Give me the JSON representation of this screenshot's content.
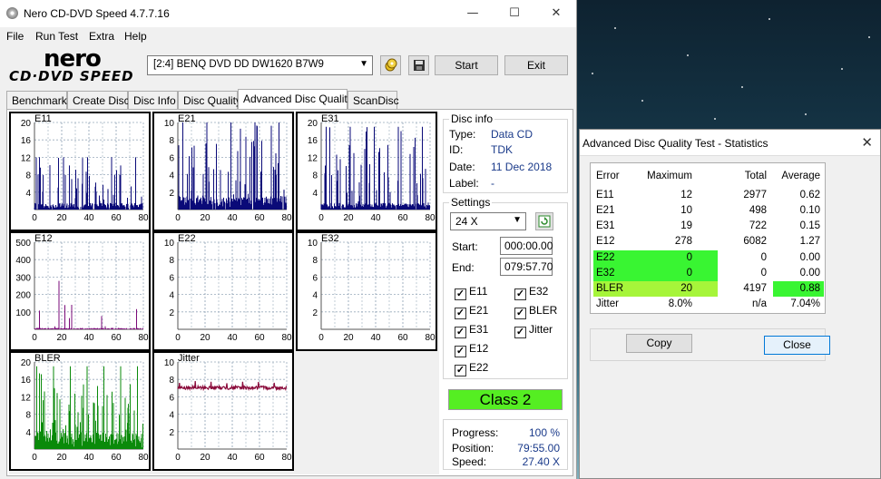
{
  "window": {
    "title": "Nero CD-DVD Speed 4.7.7.16",
    "minimize": "—",
    "maximize": "☐",
    "close": "✕"
  },
  "menu": [
    "File",
    "Run Test",
    "Extra",
    "Help"
  ],
  "logo": {
    "top": "nero",
    "bottom": "CD·DVD SPEED"
  },
  "toolbar": {
    "drive": "[2:4]   BENQ DVD DD DW1620 B7W9",
    "start_label": "Start",
    "exit_label": "Exit"
  },
  "tabs": [
    "Benchmark",
    "Create Disc",
    "Disc Info",
    "Disc Quality",
    "Advanced Disc Quality",
    "ScanDisc"
  ],
  "active_tab": "Advanced Disc Quality",
  "disc_info": {
    "title": "Disc info",
    "type_label": "Type:",
    "type": "Data CD",
    "id_label": "ID:",
    "id": "TDK",
    "date_label": "Date:",
    "date": "11 Dec 2018",
    "label_label": "Label:",
    "label": "-"
  },
  "settings": {
    "title": "Settings",
    "speed": "24 X",
    "start_label": "Start:",
    "start": "000:00.00",
    "end_label": "End:",
    "end": "079:57.70",
    "checks": [
      "E11",
      "E32",
      "E21",
      "BLER",
      "E31",
      "Jitter",
      "E12",
      "E22"
    ]
  },
  "class_label": "Class 2",
  "progress": {
    "progress_label": "Progress:",
    "progress": "100 %",
    "position_label": "Position:",
    "position": "79:55.00",
    "speed_label": "Speed:",
    "speed": "27.40 X"
  },
  "dialog": {
    "title": "Advanced Disc Quality Test - Statistics",
    "headers": [
      "Error",
      "Maximum",
      "Total",
      "Average"
    ],
    "rows": [
      [
        "E11",
        "12",
        "2977",
        "0.62"
      ],
      [
        "E21",
        "10",
        "498",
        "0.10"
      ],
      [
        "E31",
        "19",
        "722",
        "0.15"
      ],
      [
        "E12",
        "278",
        "6082",
        "1.27"
      ],
      [
        "E22",
        "0",
        "0",
        "0.00"
      ],
      [
        "E32",
        "0",
        "0",
        "0.00"
      ],
      [
        "BLER",
        "20",
        "4197",
        "0.88"
      ],
      [
        "Jitter",
        "8.0%",
        "n/a",
        "7.04%"
      ]
    ],
    "copy_label": "Copy",
    "close_label": "Close"
  },
  "colors": {
    "bar_blue": "#0a0a78",
    "bar_purple": "#7a0a78",
    "bar_green": "#0a8a0a",
    "jitter": "#8a0a3a",
    "pass_green": "#39f532",
    "warn_green": "#a6f53a"
  },
  "chart_data": [
    {
      "type": "bar",
      "title": "E11",
      "x": [
        0,
        80
      ],
      "xticks": [
        0,
        20,
        40,
        60,
        80
      ],
      "yticks": [
        4,
        8,
        12,
        16,
        20
      ],
      "ylim": [
        0,
        20
      ],
      "series_max": 12
    },
    {
      "type": "bar",
      "title": "E21",
      "x": [
        0,
        80
      ],
      "xticks": [
        0,
        20,
        40,
        60,
        80
      ],
      "yticks": [
        2,
        4,
        6,
        8,
        10
      ],
      "ylim": [
        0,
        10
      ],
      "series_max": 10
    },
    {
      "type": "bar",
      "title": "E31",
      "x": [
        0,
        80
      ],
      "xticks": [
        0,
        20,
        40,
        60,
        80
      ],
      "yticks": [
        4,
        8,
        12,
        16,
        20
      ],
      "ylim": [
        0,
        20
      ],
      "series_max": 19
    },
    {
      "type": "bar",
      "title": "E12",
      "x": [
        0,
        80
      ],
      "xticks": [
        0,
        20,
        40,
        60,
        80
      ],
      "yticks": [
        100,
        200,
        300,
        400,
        500
      ],
      "ylim": [
        0,
        500
      ],
      "series_max": 278
    },
    {
      "type": "bar",
      "title": "E22",
      "x": [
        0,
        80
      ],
      "xticks": [
        0,
        20,
        40,
        60,
        80
      ],
      "yticks": [
        2,
        4,
        6,
        8,
        10
      ],
      "ylim": [
        0,
        10
      ],
      "series_max": 0
    },
    {
      "type": "bar",
      "title": "E32",
      "x": [
        0,
        80
      ],
      "xticks": [
        0,
        20,
        40,
        60,
        80
      ],
      "yticks": [
        2,
        4,
        6,
        8,
        10
      ],
      "ylim": [
        0,
        10
      ],
      "series_max": 0
    },
    {
      "type": "bar",
      "title": "BLER",
      "x": [
        0,
        80
      ],
      "xticks": [
        0,
        20,
        40,
        60,
        80
      ],
      "yticks": [
        4,
        8,
        12,
        16,
        20
      ],
      "ylim": [
        0,
        20
      ],
      "series_max": 20
    },
    {
      "type": "line",
      "title": "Jitter",
      "x": [
        0,
        80
      ],
      "xticks": [
        0,
        20,
        40,
        60,
        80
      ],
      "yticks": [
        2,
        4,
        6,
        8,
        10
      ],
      "ylim": [
        0,
        10
      ],
      "series_level": 7.04
    }
  ]
}
